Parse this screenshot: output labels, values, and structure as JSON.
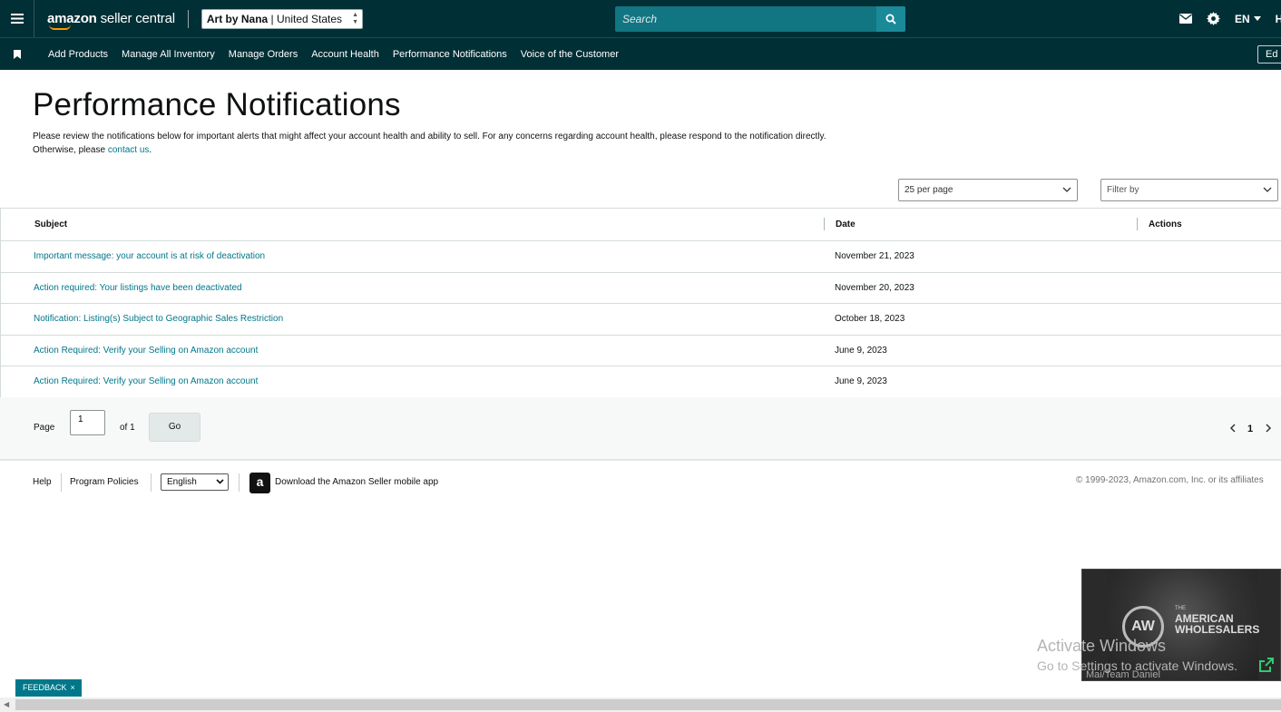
{
  "header": {
    "logo_text_bold": "amazon",
    "logo_text_rest": " seller central",
    "store_name": "Art by Nana",
    "store_region": "United States",
    "search_placeholder": "Search",
    "language": "EN",
    "truncated_label": "Ho"
  },
  "nav": {
    "items": [
      {
        "label": "Add Products"
      },
      {
        "label": "Manage All Inventory"
      },
      {
        "label": "Manage Orders"
      },
      {
        "label": "Account Health"
      },
      {
        "label": "Performance Notifications"
      },
      {
        "label": "Voice of the Customer"
      }
    ],
    "edit_label": "Ed"
  },
  "page": {
    "title": "Performance Notifications",
    "description_line1": "Please review the notifications below for important alerts that might affect your account health and ability to sell. For any concerns regarding account health, please respond to the notification directly.",
    "description_line2_prefix": "Otherwise, please ",
    "description_link": "contact us",
    "description_suffix": "."
  },
  "controls": {
    "per_page": "25 per page",
    "filter_placeholder": "Filter by"
  },
  "table": {
    "columns": [
      "Subject",
      "Date",
      "Actions"
    ],
    "rows": [
      {
        "subject": "Important message: your account is at risk of deactivation",
        "date": "November 21, 2023"
      },
      {
        "subject": "Action required: Your listings have been deactivated",
        "date": "November 20, 2023"
      },
      {
        "subject": "Notification: Listing(s) Subject to Geographic Sales Restriction",
        "date": "October 18, 2023"
      },
      {
        "subject": "Action Required: Verify your Selling on Amazon account",
        "date": "June 9, 2023"
      },
      {
        "subject": "Action Required: Verify your Selling on Amazon account",
        "date": "June 9, 2023"
      }
    ]
  },
  "pagination": {
    "page_label": "Page",
    "page_value": "1",
    "of_label": "of 1",
    "go_label": "Go",
    "current_page": "1"
  },
  "footer": {
    "help": "Help",
    "program_policies": "Program Policies",
    "language": "English",
    "app_link": "Download the Amazon Seller mobile app",
    "copyright": "© 1999-2023, Amazon.com, Inc. or its affiliates"
  },
  "video": {
    "brand_small": "THE",
    "brand_line1": "AMERICAN",
    "brand_line2": "WHOLESALERS",
    "logo_letters": "AW",
    "caption": "Mai/Team Daniel"
  },
  "windows": {
    "activate_title": "Activate Windows",
    "activate_sub": "Go to Settings to activate Windows."
  },
  "feedback": {
    "label": "FEEDBACK",
    "close": "×"
  },
  "colors": {
    "header_bg": "#002f36",
    "search_bg": "#127582",
    "link": "#00778a",
    "accent": "#ff9900"
  }
}
